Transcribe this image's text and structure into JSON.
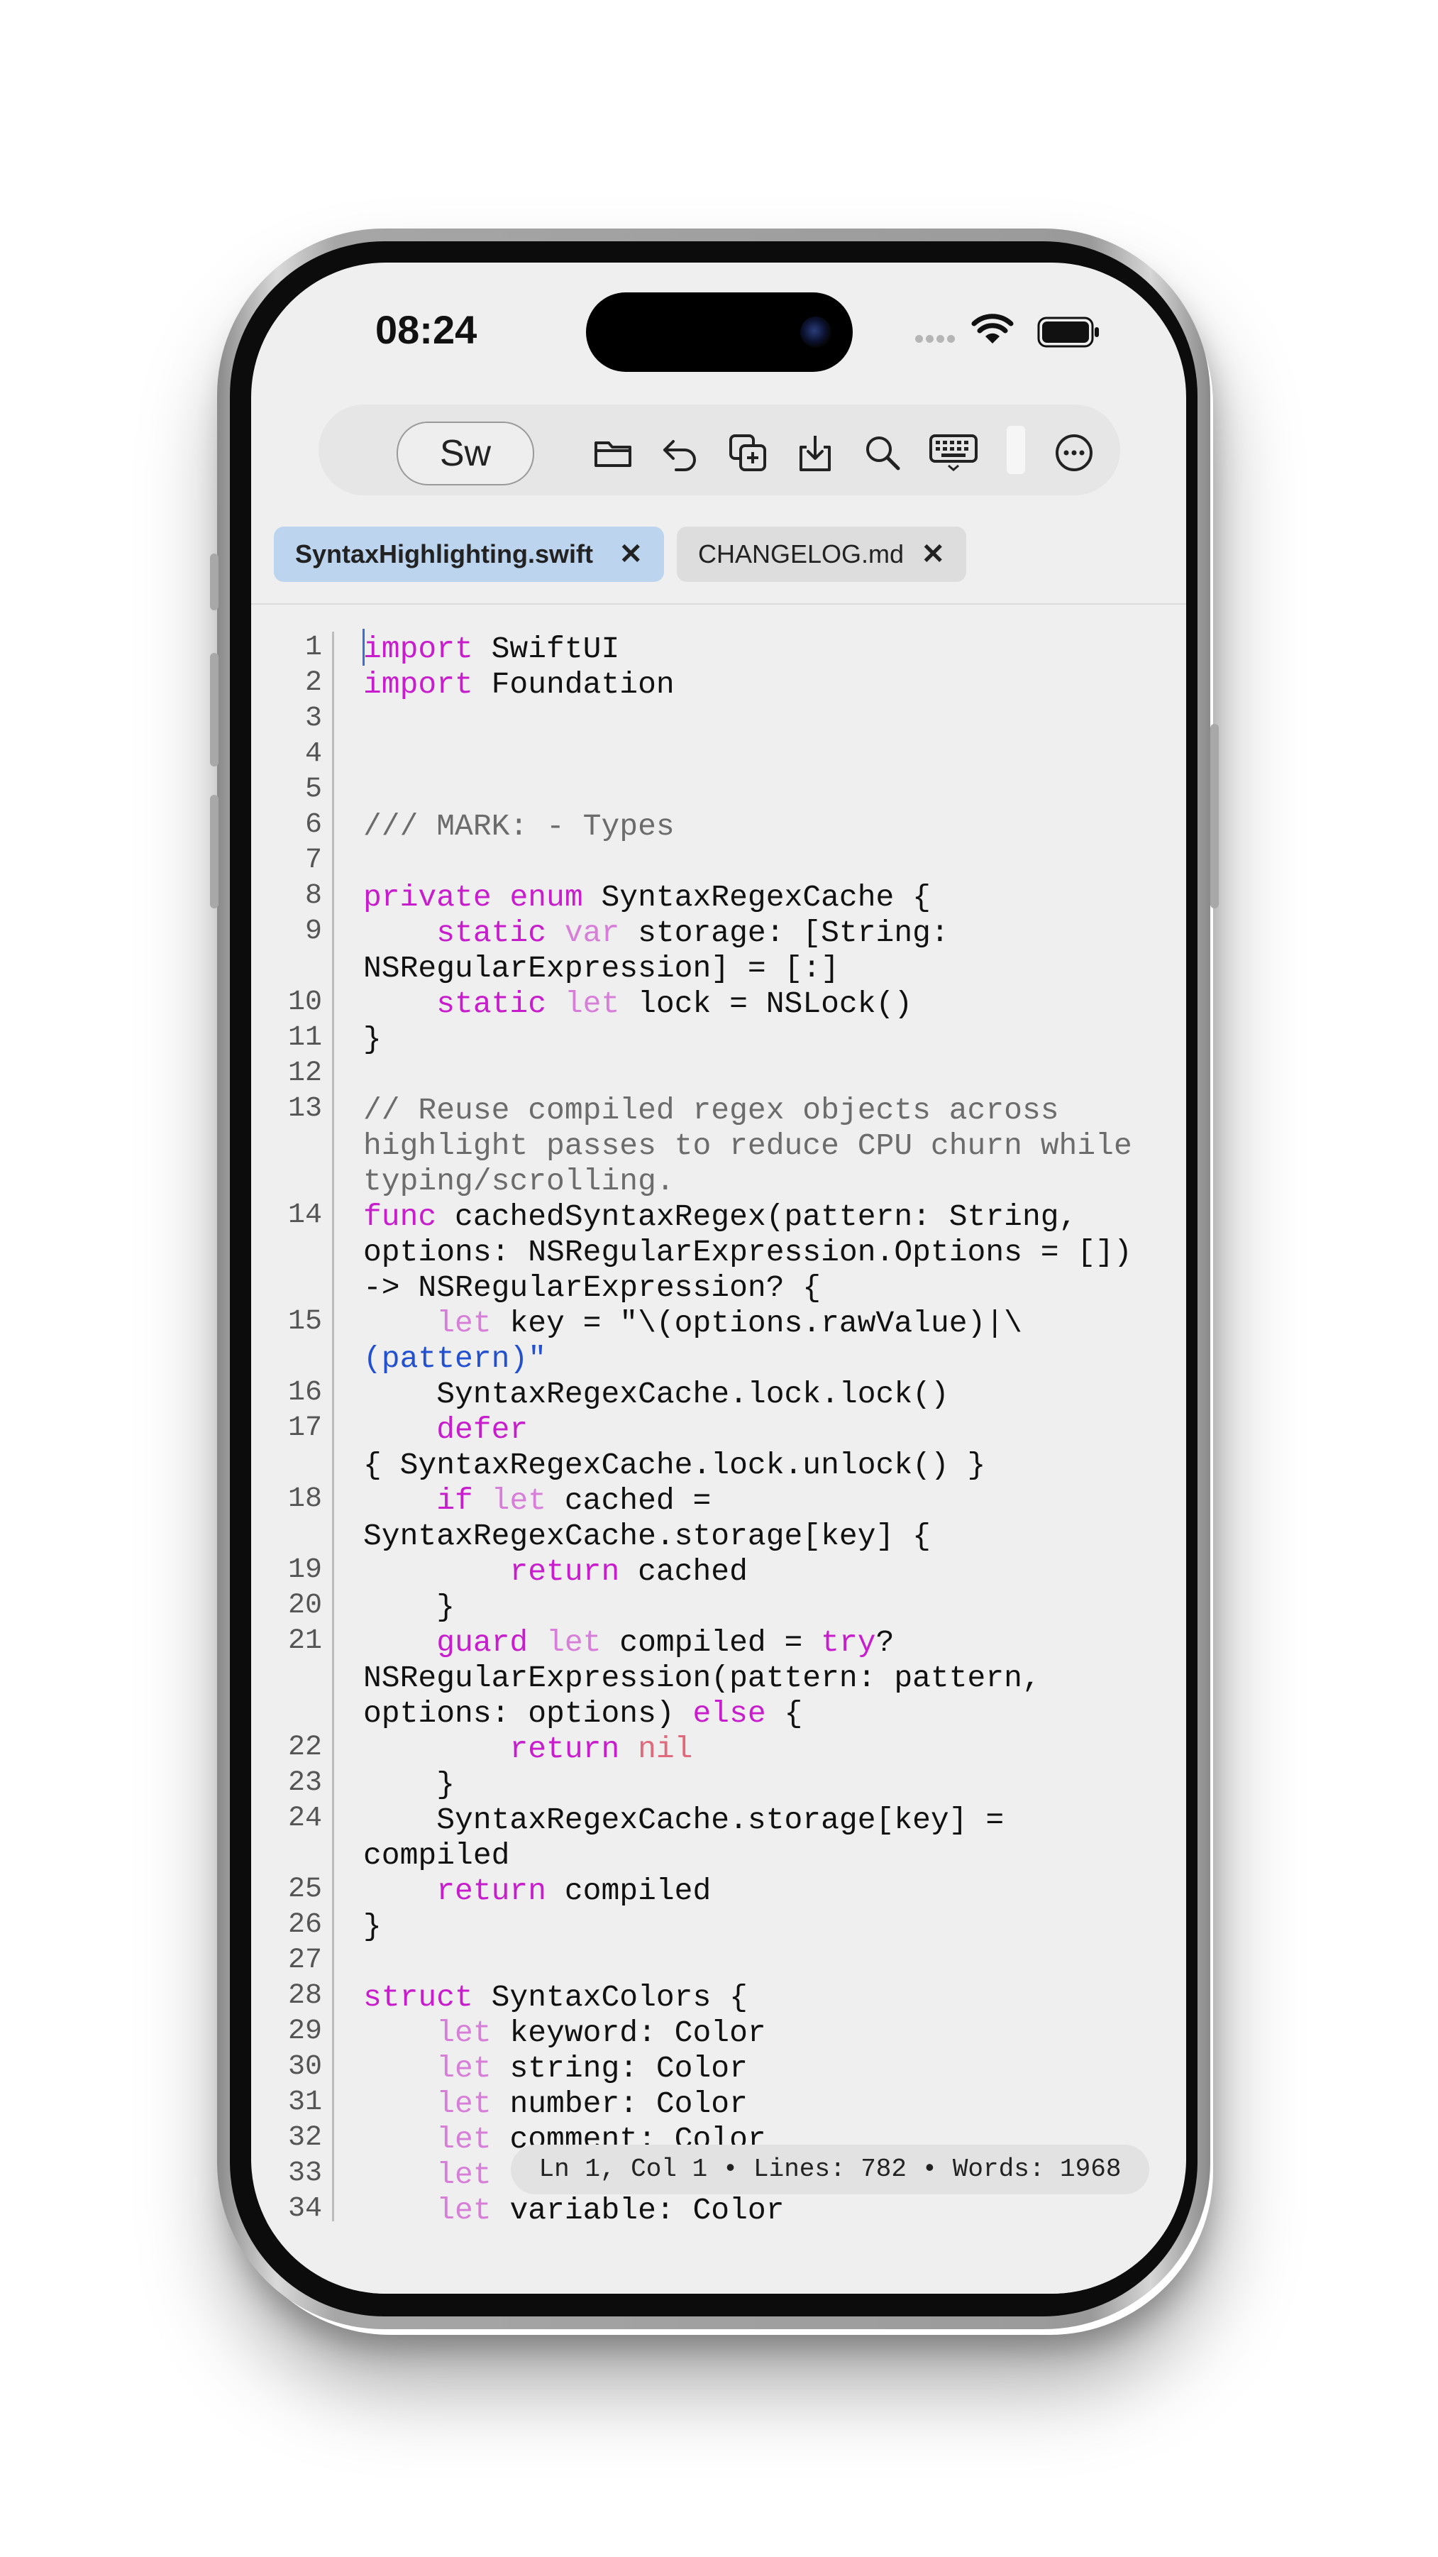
{
  "status_bar": {
    "time": "08:24",
    "icons": [
      "signal-dots-icon",
      "wifi-icon",
      "battery-icon"
    ]
  },
  "toolbar": {
    "language_button": "Sw",
    "icons": [
      "folder-icon",
      "undo-icon",
      "duplicate-icon",
      "download-icon",
      "search-icon",
      "keyboard-icon",
      "more-icon"
    ]
  },
  "tabs": [
    {
      "label": "SyntaxHighlighting.swift",
      "close": "✕",
      "active": true
    },
    {
      "label": "CHANGELOG.md",
      "close": "✕",
      "active": false
    }
  ],
  "editor": {
    "line_numbers": [
      "1",
      "2",
      "3",
      "4",
      "5",
      "6",
      "7",
      "8",
      "9",
      "10",
      "11",
      "12",
      "13",
      "14",
      "15",
      "16",
      "17",
      "18",
      "19",
      "20",
      "21",
      "22",
      "23",
      "24",
      "25",
      "26",
      "27",
      "28",
      "29",
      "30",
      "31",
      "32",
      "33",
      "34"
    ],
    "code_text": [
      "import SwiftUI",
      "import Foundation",
      "/// MARK: - Types",
      "private enum SyntaxRegexCache {",
      "    static var storage: [String:",
      "NSRegularExpression] = [:]",
      "    static let lock = NSLock()",
      "}",
      "// Reuse compiled regex objects across",
      "highlight passes to reduce CPU churn while",
      "typing/scrolling.",
      "func cachedSyntaxRegex(pattern: String,",
      "options: NSRegularExpression.Options = [])",
      "-> NSRegularExpression? {",
      "    let key = \"\\(options.rawValue)|\\",
      "(pattern)\"",
      "    SyntaxRegexCache.lock.lock()",
      "    defer",
      "{ SyntaxRegexCache.lock.unlock() }",
      "    if let cached =",
      "SyntaxRegexCache.storage[key] {",
      "        return cached",
      "    }",
      "    guard let compiled = try?",
      "NSRegularExpression(pattern: pattern,",
      "options: options) else {",
      "        return nil",
      "    }",
      "    SyntaxRegexCache.storage[key] =",
      "compiled",
      "    return compiled",
      "}",
      "struct SyntaxColors {",
      "    let keyword: Color",
      "    let string: Color",
      "    let number: Color",
      "    let comment: Color",
      "    let",
      "    let variable: Color"
    ]
  },
  "status_pill": "Ln 1, Col 1 • Lines: 782 • Words: 1968",
  "colors": {
    "keyword": "#c81dcc",
    "type": "#35c05b",
    "comment": "#6c6c6c",
    "string": "#2250d0",
    "active_tab": "#bdd4ef"
  }
}
